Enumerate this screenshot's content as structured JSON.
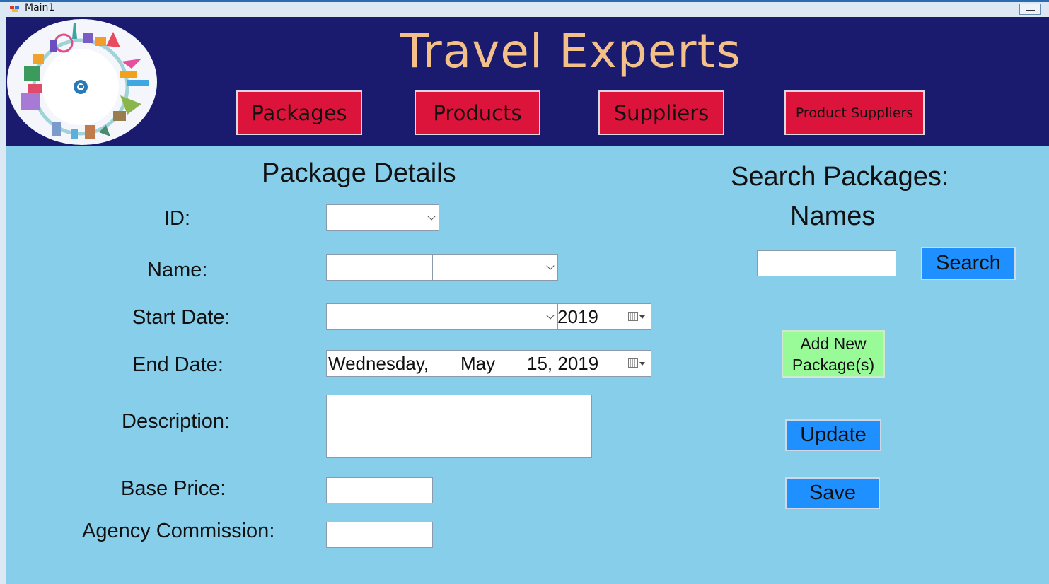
{
  "window": {
    "title": "Main1"
  },
  "header": {
    "app_title": "Travel Experts",
    "nav": {
      "packages": "Packages",
      "products": "Products",
      "suppliers": "Suppliers",
      "product_suppliers": "Product Suppliers"
    }
  },
  "details": {
    "heading": "Package Details",
    "id_label": "ID:",
    "name_label": "Name:",
    "start_label": "Start Date:",
    "start_year": "2019",
    "end_label": "End Date:",
    "end_date": {
      "weekday": "Wednesday,",
      "month": "May",
      "day_year": "15, 2019"
    },
    "description_label": "Description:",
    "base_price_label": "Base Price:",
    "commission_label": "Agency Commission:"
  },
  "search": {
    "heading": "Search Packages:",
    "subheading": "Names",
    "button": "Search"
  },
  "actions": {
    "add_line1": "Add New",
    "add_line2": "Package(s)",
    "update": "Update",
    "save": "Save"
  },
  "colors": {
    "background": "#87CEEB",
    "header": "#1A1A6E",
    "title": "#F4C08A",
    "nav_button": "#DC143C",
    "action_button": "#1E90FF",
    "add_button": "#98FB98"
  }
}
